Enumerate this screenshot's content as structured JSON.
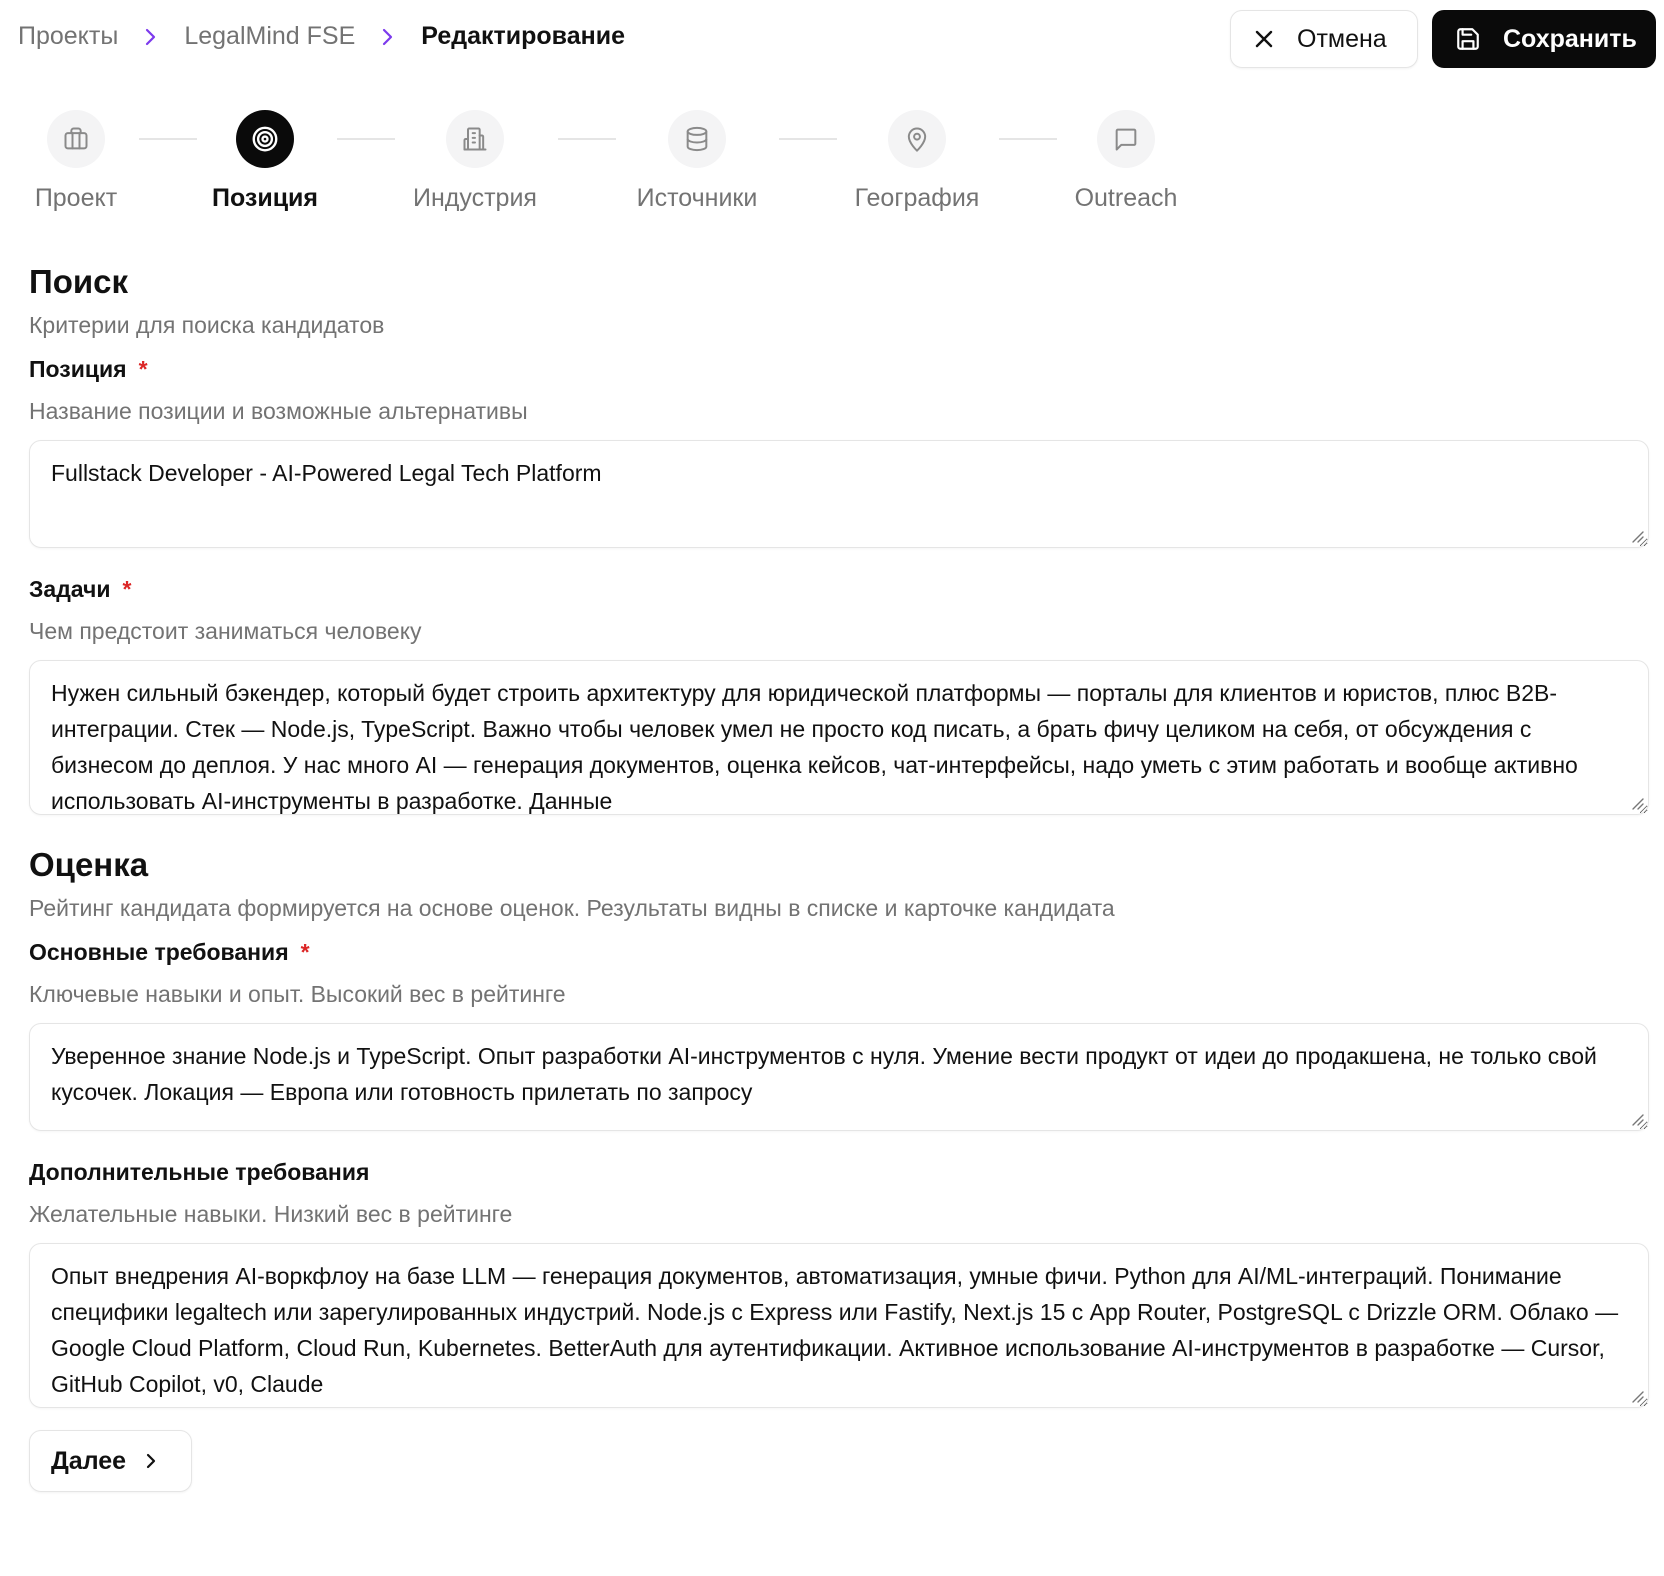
{
  "breadcrumb": {
    "items": [
      "Проекты",
      "LegalMind FSE"
    ],
    "current": "Редактирование"
  },
  "actions": {
    "cancel_label": "Отмена",
    "save_label": "Сохранить"
  },
  "stepper": {
    "steps": [
      {
        "label": "Проект",
        "icon": "briefcase-icon"
      },
      {
        "label": "Позиция",
        "icon": "target-icon",
        "active": true
      },
      {
        "label": "Индустрия",
        "icon": "building-icon"
      },
      {
        "label": "Источники",
        "icon": "database-icon"
      },
      {
        "label": "География",
        "icon": "map-pin-icon"
      },
      {
        "label": "Outreach",
        "icon": "message-square-icon"
      }
    ]
  },
  "search": {
    "title": "Поиск",
    "description": "Критерии для поиска кандидатов",
    "position": {
      "label": "Позиция",
      "required_mark": "*",
      "help": "Название позиции и возможные альтернативы",
      "value": "Fullstack Developer - AI-Powered Legal Tech Platform"
    },
    "tasks": {
      "label": "Задачи",
      "required_mark": "*",
      "help": "Чем предстоит заниматься человеку",
      "value": "Нужен сильный бэкендер, который будет строить архитектуру для юридической платформы — порталы для клиентов и юристов, плюс B2B-интеграции. Стек — Node.js, TypeScript. Важно чтобы человек умел не просто код писать, а брать фичу целиком на себя, от обсуждения с бизнесом до деплоя. У нас много AI — генерация документов, оценка кейсов, чат-интерфейсы, надо уметь с этим работать и вообще активно использовать AI-инструменты в разработке. Данные"
    }
  },
  "evaluation": {
    "title": "Оценка",
    "description": "Рейтинг кандидата формируется на основе оценок. Результаты видны в списке и карточке кандидата",
    "core": {
      "label": "Основные требования",
      "required_mark": "*",
      "help": "Ключевые навыки и опыт. Высокий вес в рейтинге",
      "value": "Уверенное знание Node.js и TypeScript. Опыт разработки AI-инструментов с нуля. Умение вести продукт от идеи до продакшена, не только свой кусочек. Локация — Европа или готовность прилетать по запросу"
    },
    "extra": {
      "label": "Дополнительные требования",
      "help": "Желательные навыки. Низкий вес в рейтинге",
      "value": "Опыт внедрения AI-воркфлоу на базе LLM — генерация документов, автоматизация, умные фичи. Python для AI/ML-интеграций. Понимание специфики legaltech или зарегулированных индустрий. Node.js с Express или Fastify, Next.js 15 с App Router, PostgreSQL с Drizzle ORM. Облако — Google Cloud Platform, Cloud Run, Kubernetes. BetterAuth для аутентификации. Активное использование AI-инструментов в разработке — Cursor, GitHub Copilot, v0, Claude"
    }
  },
  "next_label": "Далее"
}
